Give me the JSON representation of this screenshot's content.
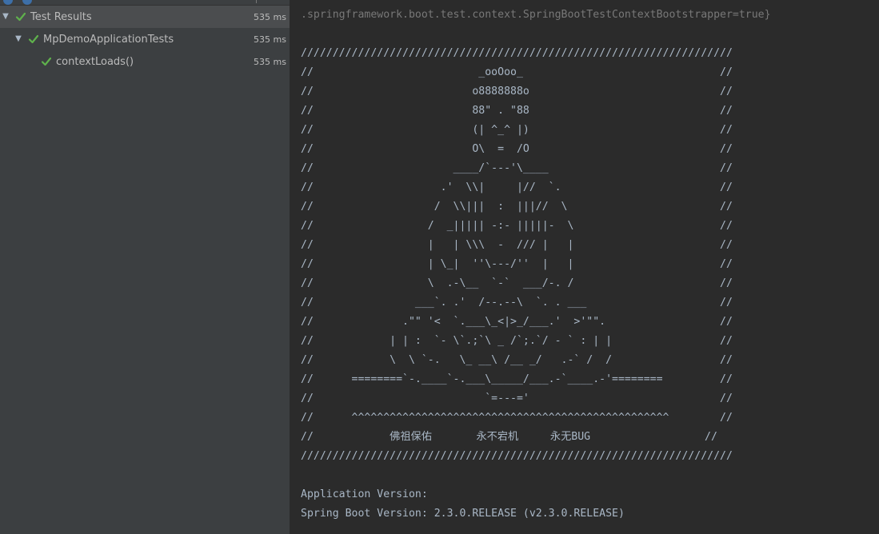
{
  "test_tree": {
    "rows": [
      {
        "label": "Test Results",
        "time": "535 ms",
        "status": "passed",
        "expanded": true,
        "selected": true
      },
      {
        "label": "MpDemoApplicationTests",
        "time": "535 ms",
        "status": "passed",
        "expanded": true,
        "selected": false
      },
      {
        "label": "contextLoads()",
        "time": "535 ms",
        "status": "passed",
        "expanded": false,
        "selected": false
      }
    ],
    "arrow_icon": "▼",
    "check_icon": "check-icon"
  },
  "console": {
    "lines": [
      ".springframework.boot.test.context.SpringBootTestContextBootstrapper=true}",
      "",
      "////////////////////////////////////////////////////////////////////",
      "//                          _ooOoo_                               //",
      "//                         o8888888o                              //",
      "//                         88\" . \"88                              //",
      "//                         (| ^_^ |)                              //",
      "//                         O\\  =  /O                              //",
      "//                      ____/`---'\\____                           //",
      "//                    .'  \\\\|     |//  `.                         //",
      "//                   /  \\\\|||  :  |||//  \\                        //",
      "//                  /  _||||| -:- |||||-  \\                       //",
      "//                  |   | \\\\\\  -  /// |   |                       //",
      "//                  | \\_|  ''\\---/''  |   |                       //",
      "//                  \\  .-\\__  `-`  ___/-. /                       //",
      "//                ___`. .'  /--.--\\  `. . ___                     //",
      "//              .\"\" '<  `.___\\_<|>_/___.'  >'\"\".                  //",
      "//            | | :  `- \\`.;`\\ _ /`;.`/ - ` : | |                 //",
      "//            \\  \\ `-.   \\_ __\\ /__ _/   .-` /  /                 //",
      "//      ========`-.____`-.___\\_____/___.-`____.-'========         //",
      "//                           `=---='                              //",
      "//      ^^^^^^^^^^^^^^^^^^^^^^^^^^^^^^^^^^^^^^^^^^^^^^^^^^        //",
      "//            佛祖保佑       永不宕机     永无BUG                  //",
      "////////////////////////////////////////////////////////////////////",
      "",
      "Application Version:",
      "Spring Boot Version: 2.3.0.RELEASE (v2.3.0.RELEASE)"
    ],
    "first_line_dim": true
  },
  "colors": {
    "tree_bg": "#3c3f41",
    "tree_selected_bg": "#4b4d4f",
    "console_bg": "#2b2b2b",
    "console_text": "#a9b7c6",
    "check_green": "#5fb14c"
  }
}
